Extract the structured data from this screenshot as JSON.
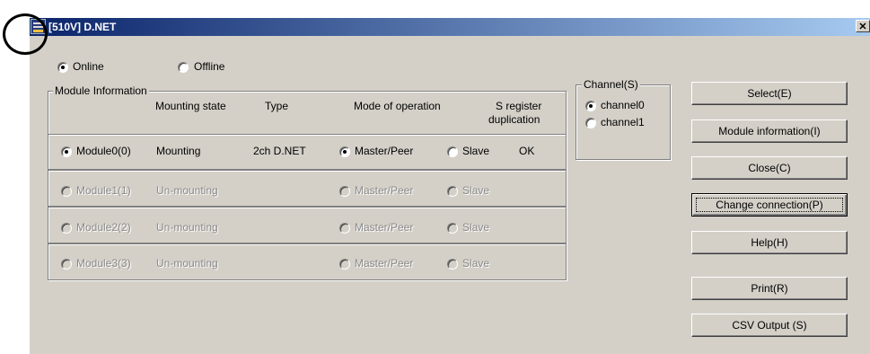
{
  "window": {
    "title": "[510V] D.NET",
    "close_glyph": "✕"
  },
  "mode": {
    "online_label": "Online",
    "offline_label": "Offline",
    "selected": "online"
  },
  "module_info": {
    "group_title": "Module Information",
    "headers": {
      "mounting_state": "Mounting state",
      "type": "Type",
      "mode_of_operation": "Mode of operation",
      "s_register_line1": "S register",
      "s_register_line2": "duplication"
    },
    "rows": [
      {
        "name": "Module0(0)",
        "state": "Mounting",
        "type": "2ch D.NET",
        "master": "Master/Peer",
        "slave": "Slave",
        "dup": "OK",
        "enabled": true,
        "mode": "master"
      },
      {
        "name": "Module1(1)",
        "state": "Un-mounting",
        "type": "",
        "master": "Master/Peer",
        "slave": "Slave",
        "dup": "",
        "enabled": false,
        "mode": ""
      },
      {
        "name": "Module2(2)",
        "state": "Un-mounting",
        "type": "",
        "master": "Master/Peer",
        "slave": "Slave",
        "dup": "",
        "enabled": false,
        "mode": ""
      },
      {
        "name": "Module3(3)",
        "state": "Un-mounting",
        "type": "",
        "master": "Master/Peer",
        "slave": "Slave",
        "dup": "",
        "enabled": false,
        "mode": ""
      }
    ]
  },
  "channel": {
    "group_title": "Channel(S)",
    "channel0": "channel0",
    "channel1": "channel1",
    "selected": "channel0"
  },
  "buttons": {
    "select": "Select(E)",
    "module_information": "Module information(I)",
    "close": "Close(C)",
    "change_connection": "Change connection(P)",
    "help": "Help(H)",
    "print": "Print(R)",
    "csv_output": "CSV Output (S)"
  },
  "icons": {
    "app": "dnet-app-icon"
  },
  "colors": {
    "titlebar_start": "#0a246a",
    "titlebar_end": "#a6caf0",
    "face": "#d4d0c8"
  }
}
